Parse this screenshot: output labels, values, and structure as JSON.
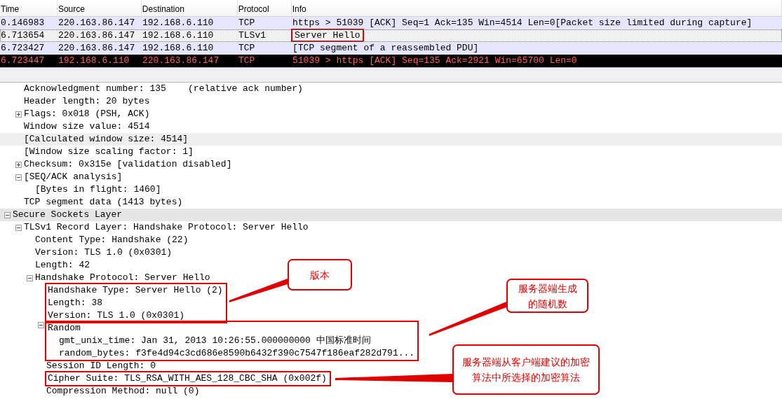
{
  "packet_list": {
    "columns": [
      "Time",
      "Source",
      "Destination",
      "Protocol",
      "Info"
    ],
    "rows": [
      {
        "cells": [
          "0.146983",
          "220.163.86.147",
          "192.168.6.110",
          "TCP",
          "https > 51039 [ACK] Seq=1 Ack=135 Win=4514 Len=0[Packet size limited during capture]"
        ],
        "color": "#e7e6ff",
        "kind": "normal",
        "selected": false,
        "info_boxed": false
      },
      {
        "cells": [
          "6.713654",
          "220.163.86.147",
          "192.168.6.110",
          "TLSv1",
          "Server Hello"
        ],
        "color": "#f0f0f0",
        "kind": "normal",
        "selected": true,
        "info_boxed": true
      },
      {
        "cells": [
          "6.723427",
          "220.163.86.147",
          "192.168.6.110",
          "TCP",
          "[TCP segment of a reassembled PDU]"
        ],
        "color": "#e7e6ff",
        "kind": "normal",
        "selected": false,
        "info_boxed": false
      },
      {
        "cells": [
          "6.723447",
          "192.168.6.110",
          "220.163.86.147",
          "TCP",
          "51039 > https [ACK] Seq=135 Ack=2921 Win=65700 Len=0"
        ],
        "color": "#000000",
        "kind": "alert",
        "selected": false,
        "info_boxed": false
      }
    ]
  },
  "details": {
    "tcp_continued": [
      {
        "label": "Acknowledgment number: 135    (relative ack number)",
        "selected": false
      },
      {
        "label": "Header length: 20 bytes",
        "selected": false
      },
      {
        "label": "Flags: 0x018 (PSH, ACK)",
        "selected": false,
        "expanded": false
      },
      {
        "label": "Window size value: 4514",
        "selected": false
      },
      {
        "label": "[Calculated window size: 4514]",
        "selected": true
      },
      {
        "label": "[Window size scaling factor: 1]",
        "selected": false
      },
      {
        "label": "Checksum: 0x315e [validation disabled]",
        "selected": false,
        "expanded": false
      },
      {
        "label": "[SEQ/ACK analysis]",
        "selected": false,
        "expanded": true,
        "children": [
          {
            "label": "[Bytes in flight: 1460]",
            "selected": false
          }
        ]
      },
      {
        "label": "TCP segment data (1413 bytes)",
        "selected": false
      }
    ],
    "tree": [
      {
        "label": "Secure Sockets Layer",
        "selected": false,
        "expanded": true,
        "children": [
          {
            "label": "TLSv1 Record Layer: Handshake Protocol: Server Hello",
            "selected": false,
            "expanded": true,
            "children": [
              {
                "label": "Content Type: Handshake (22)",
                "selected": false
              },
              {
                "label": "Version: TLS 1.0 (0x0301)",
                "selected": false
              },
              {
                "label": "Length: 42",
                "selected": false
              },
              {
                "label": "Handshake Protocol: Server Hello",
                "selected": false,
                "expanded": true,
                "children": [
                  {
                    "label": "Handshake Type: Server Hello (2)",
                    "selected": false,
                    "boxed": true
                  },
                  {
                    "label": "Length: 38",
                    "selected": false,
                    "boxed": true
                  },
                  {
                    "label": "Version: TLS 1.0 (0x0301)",
                    "selected": false,
                    "boxed": true
                  },
                  {
                    "label": "Random",
                    "selected": false,
                    "boxed": true,
                    "expanded": true,
                    "children": [
                      {
                        "label": "gmt_unix_time: Jan 31, 2013 10:26:55.000000000 中国标准时间",
                        "selected": false
                      },
                      {
                        "label": "random_bytes: f3fe4d94c3cd686e8590b6432f390c7547f186eaf282d791...",
                        "selected": false
                      }
                    ]
                  },
                  {
                    "label": "Session ID Length: 0",
                    "selected": false
                  },
                  {
                    "label": "Cipher Suite: TLS_RSA_WITH_AES_128_CBC_SHA (0x002f)",
                    "selected": false,
                    "boxed": true
                  },
                  {
                    "label": "Compression Method: null (0)",
                    "selected": false
                  }
                ]
              }
            ]
          }
        ]
      }
    ]
  },
  "annotations": [
    {
      "text": "版本"
    },
    {
      "text": "服务器端生成的随机数"
    },
    {
      "text": "服务器端从客户端建议的加密算法中所选择的加密算法"
    }
  ]
}
